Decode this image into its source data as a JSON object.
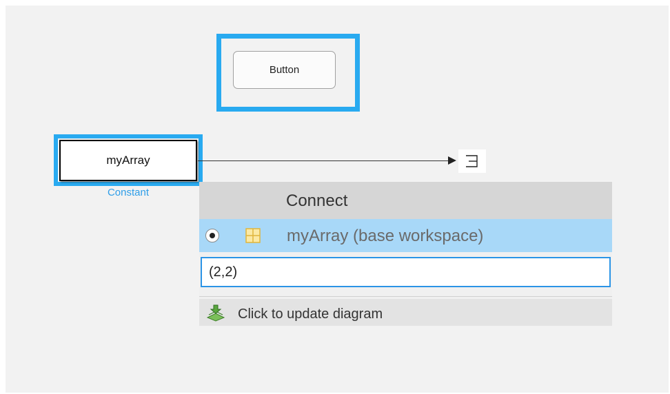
{
  "canvas": {
    "button_block": {
      "label": "Button"
    },
    "constant_block": {
      "value": "myArray",
      "type_label": "Constant"
    }
  },
  "connect_popup": {
    "title": "Connect",
    "options": [
      {
        "label": "myArray (base workspace)",
        "selected": true,
        "icon": "variable-grid-icon"
      }
    ],
    "index_input": {
      "value": "(2,2)"
    },
    "update_action": {
      "label": "Click to update diagram",
      "icon": "update-diagram-icon"
    }
  },
  "colors": {
    "selection_highlight": "#29aaf0",
    "constant_label": "#2f9ee8",
    "selected_option_bg": "#a8d8f8",
    "input_border": "#2b94e6"
  }
}
